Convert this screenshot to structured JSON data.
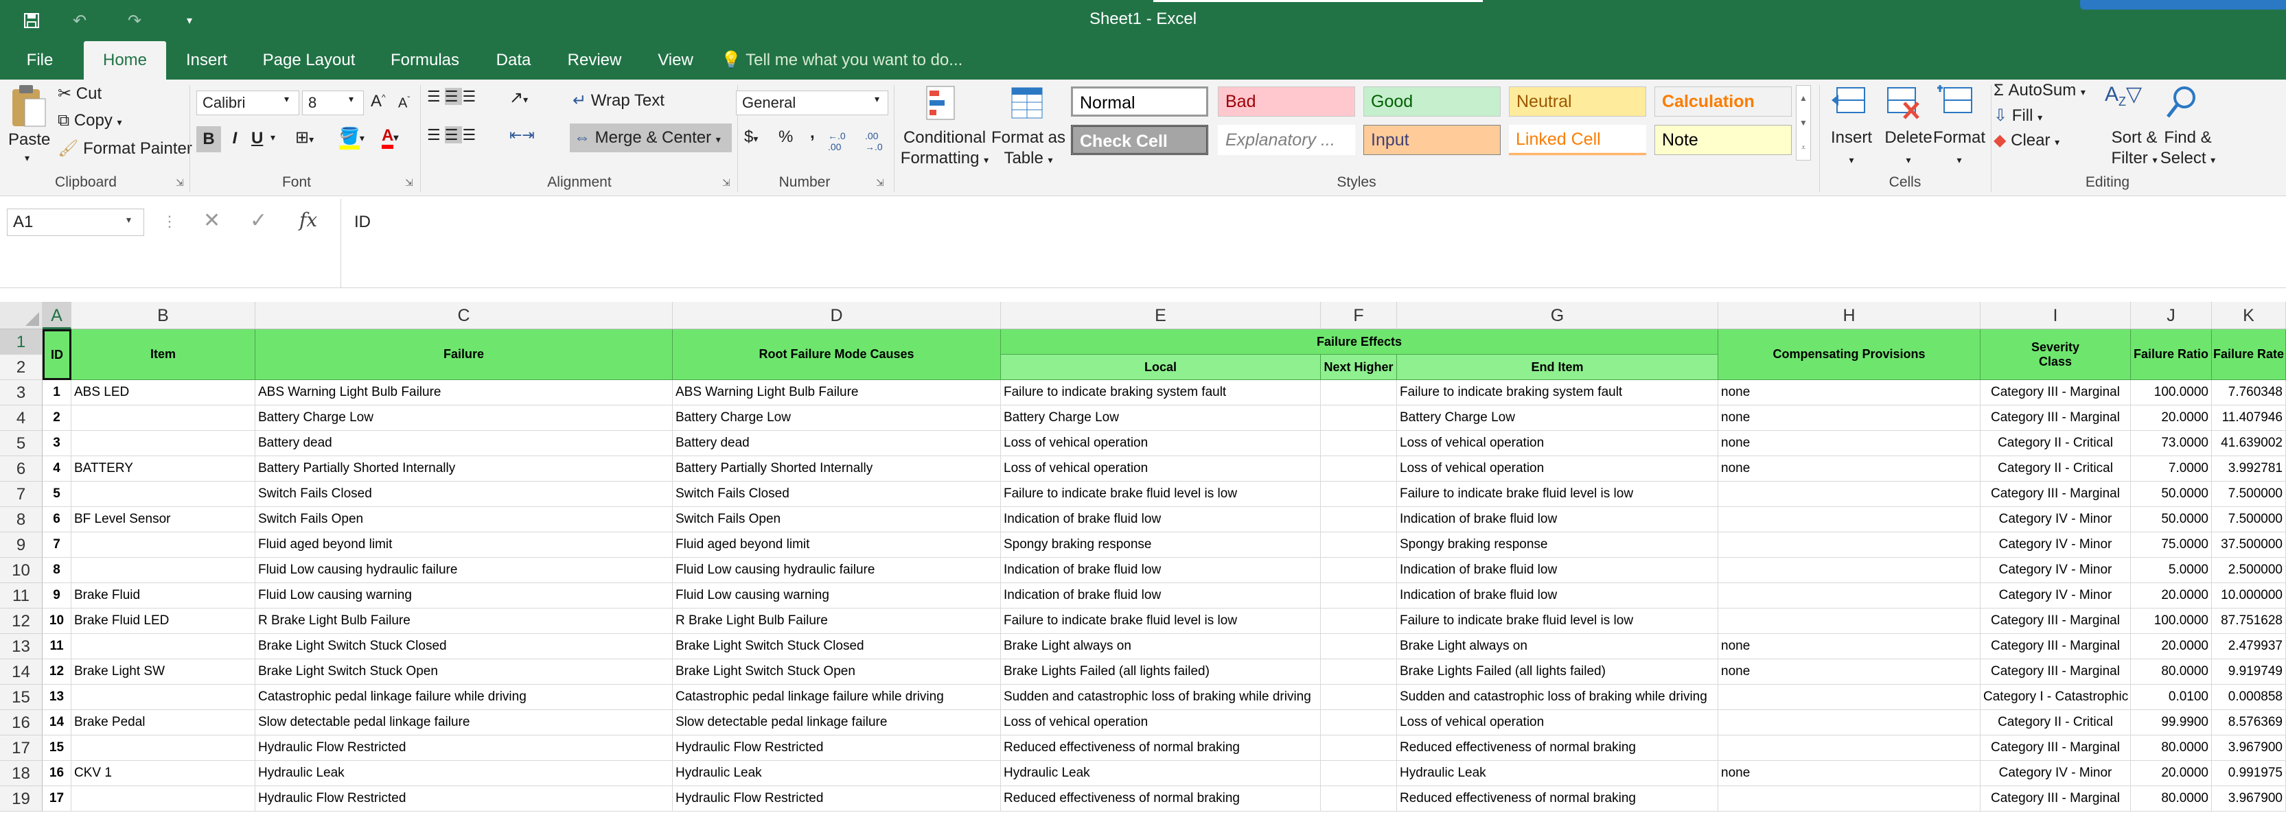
{
  "window": {
    "title": "Sheet1 - Excel"
  },
  "tabs": [
    {
      "label": "File"
    },
    {
      "label": "Home"
    },
    {
      "label": "Insert"
    },
    {
      "label": "Page Layout"
    },
    {
      "label": "Formulas"
    },
    {
      "label": "Data"
    },
    {
      "label": "Review"
    },
    {
      "label": "View"
    }
  ],
  "tellme": "Tell me what you want to do...",
  "clipboard": {
    "paste": "Paste",
    "cut": "Cut",
    "copy": "Copy",
    "format_painter": "Format Painter",
    "label": "Clipboard"
  },
  "font": {
    "name": "Calibri",
    "size": "8",
    "label": "Font",
    "bold": "B",
    "italic": "I",
    "underline": "U"
  },
  "alignment": {
    "wrap": "Wrap Text",
    "merge": "Merge & Center",
    "label": "Alignment"
  },
  "number": {
    "format": "General",
    "label": "Number",
    "currency": "$",
    "percent": "%",
    "comma": ","
  },
  "styles": {
    "conditional": "Conditional",
    "formatting": "Formatting",
    "format_as": "Format as",
    "table": "Table",
    "label": "Styles",
    "items": [
      {
        "label": "Normal",
        "bg": "#ffffff",
        "fg": "#000000"
      },
      {
        "label": "Bad",
        "bg": "#ffc7ce",
        "fg": "#9c0006"
      },
      {
        "label": "Good",
        "bg": "#c6efce",
        "fg": "#006100"
      },
      {
        "label": "Neutral",
        "bg": "#ffeb9c",
        "fg": "#9c5700"
      },
      {
        "label": "Calculation",
        "bg": "#f2f2f2",
        "fg": "#fa7d00"
      },
      {
        "label": "Check Cell",
        "bg": "#a5a5a5",
        "fg": "#ffffff"
      },
      {
        "label": "Explanatory ...",
        "bg": "#ffffff",
        "fg": "#7f7f7f"
      },
      {
        "label": "Input",
        "bg": "#ffcc99",
        "fg": "#3f3f76"
      },
      {
        "label": "Linked Cell",
        "bg": "#ffffff",
        "fg": "#fa7d00"
      },
      {
        "label": "Note",
        "bg": "#ffffcc",
        "fg": "#000000"
      }
    ]
  },
  "cells_group": {
    "insert": "Insert",
    "delete": "Delete",
    "format": "Format",
    "label": "Cells"
  },
  "editing": {
    "autosum": "AutoSum",
    "fill": "Fill",
    "clear": "Clear",
    "sort": "Sort &",
    "filter": "Filter",
    "find": "Find &",
    "select": "Select",
    "label": "Editing"
  },
  "formula_bar": {
    "name_box": "A1",
    "fx": "fx",
    "content": "ID"
  },
  "columns": [
    "A",
    "B",
    "C",
    "D",
    "E",
    "F",
    "G",
    "H",
    "I",
    "J",
    "K"
  ],
  "header": {
    "id": "ID",
    "item": "Item",
    "failure": "Failure",
    "root": "Root Failure Mode Causes",
    "effects": "Failure Effects",
    "local": "Local",
    "next_higher": "Next Higher",
    "end_item": "End Item",
    "compensating": "Compensating Provisions",
    "severity": "Severity\nClass",
    "ratio": "Failure Ratio",
    "rate": "Failure Rate"
  },
  "row_numbers": [
    "1",
    "2",
    "3",
    "4",
    "5",
    "6",
    "7",
    "8",
    "9",
    "10",
    "11",
    "12",
    "13",
    "14",
    "15",
    "16",
    "17",
    "18",
    "19"
  ],
  "rows": [
    {
      "id": "1",
      "item": "ABS LED",
      "failure": "ABS Warning Light Bulb Failure",
      "root": "ABS Warning Light Bulb Failure",
      "local": "Failure to indicate braking system fault",
      "next": "",
      "end": "Failure to indicate braking system fault",
      "comp": "none",
      "sev": "Category III - Marginal",
      "ratio": "100.0000",
      "rate": "7.760348"
    },
    {
      "id": "2",
      "item": "",
      "failure": "Battery Charge Low",
      "root": "Battery Charge Low",
      "local": "Battery Charge Low",
      "next": "",
      "end": "Battery Charge Low",
      "comp": "none",
      "sev": "Category III - Marginal",
      "ratio": "20.0000",
      "rate": "11.407946"
    },
    {
      "id": "3",
      "item": "",
      "failure": "Battery dead",
      "root": "Battery dead",
      "local": "Loss of vehical operation",
      "next": "",
      "end": "Loss of vehical operation",
      "comp": "none",
      "sev": "Category II - Critical",
      "ratio": "73.0000",
      "rate": "41.639002"
    },
    {
      "id": "4",
      "item": "BATTERY",
      "failure": "Battery Partially Shorted Internally",
      "root": "Battery Partially Shorted Internally",
      "local": "Loss of vehical operation",
      "next": "",
      "end": "Loss of vehical operation",
      "comp": "none",
      "sev": "Category II - Critical",
      "ratio": "7.0000",
      "rate": "3.992781"
    },
    {
      "id": "5",
      "item": "",
      "failure": "Switch Fails Closed",
      "root": "Switch Fails Closed",
      "local": "Failure to indicate brake fluid level is low",
      "next": "",
      "end": "Failure to indicate brake fluid level is low",
      "comp": "",
      "sev": "Category III - Marginal",
      "ratio": "50.0000",
      "rate": "7.500000"
    },
    {
      "id": "6",
      "item": "BF Level Sensor",
      "failure": "Switch Fails Open",
      "root": "Switch Fails Open",
      "local": "Indication of brake fluid low",
      "next": "",
      "end": "Indication of brake fluid low",
      "comp": "",
      "sev": "Category IV - Minor",
      "ratio": "50.0000",
      "rate": "7.500000"
    },
    {
      "id": "7",
      "item": "",
      "failure": "Fluid aged beyond limit",
      "root": "Fluid aged beyond limit",
      "local": "Spongy braking response",
      "next": "",
      "end": "Spongy braking response",
      "comp": "",
      "sev": "Category IV - Minor",
      "ratio": "75.0000",
      "rate": "37.500000"
    },
    {
      "id": "8",
      "item": "",
      "failure": "Fluid Low causing hydraulic failure",
      "root": "Fluid Low causing hydraulic failure",
      "local": "Indication of brake fluid low",
      "next": "",
      "end": "Indication of brake fluid low",
      "comp": "",
      "sev": "Category IV - Minor",
      "ratio": "5.0000",
      "rate": "2.500000"
    },
    {
      "id": "9",
      "item": "Brake Fluid",
      "failure": "Fluid Low causing warning",
      "root": "Fluid Low causing warning",
      "local": "Indication of brake fluid low",
      "next": "",
      "end": "Indication of brake fluid low",
      "comp": "",
      "sev": "Category IV - Minor",
      "ratio": "20.0000",
      "rate": "10.000000"
    },
    {
      "id": "10",
      "item": "Brake Fluid LED",
      "failure": "R Brake Light Bulb Failure",
      "root": "R Brake Light Bulb Failure",
      "local": "Failure to indicate brake fluid level is low",
      "next": "",
      "end": "Failure to indicate brake fluid level is low",
      "comp": "",
      "sev": "Category III - Marginal",
      "ratio": "100.0000",
      "rate": "87.751628"
    },
    {
      "id": "11",
      "item": "",
      "failure": "Brake Light Switch Stuck Closed",
      "root": "Brake Light Switch Stuck Closed",
      "local": "Brake Light always on",
      "next": "",
      "end": "Brake Light always on",
      "comp": "none",
      "sev": "Category III - Marginal",
      "ratio": "20.0000",
      "rate": "2.479937"
    },
    {
      "id": "12",
      "item": "Brake Light SW",
      "failure": "Brake Light Switch Stuck Open",
      "root": "Brake Light Switch Stuck Open",
      "local": "Brake Lights Failed (all lights failed)",
      "next": "",
      "end": "Brake Lights Failed (all lights failed)",
      "comp": "none",
      "sev": "Category III - Marginal",
      "ratio": "80.0000",
      "rate": "9.919749"
    },
    {
      "id": "13",
      "item": "",
      "failure": "Catastrophic pedal linkage failure while driving",
      "root": "Catastrophic pedal linkage failure while driving",
      "local": "Sudden and catastrophic loss of braking while driving",
      "next": "",
      "end": "Sudden and catastrophic loss of braking while driving",
      "comp": "",
      "sev": "Category I - Catastrophic",
      "ratio": "0.0100",
      "rate": "0.000858"
    },
    {
      "id": "14",
      "item": "Brake Pedal",
      "failure": "Slow detectable pedal linkage failure",
      "root": "Slow detectable pedal linkage failure",
      "local": "Loss of vehical operation",
      "next": "",
      "end": "Loss of vehical operation",
      "comp": "",
      "sev": "Category II - Critical",
      "ratio": "99.9900",
      "rate": "8.576369"
    },
    {
      "id": "15",
      "item": "",
      "failure": "Hydraulic Flow Restricted",
      "root": "Hydraulic Flow Restricted",
      "local": "Reduced effectiveness of normal braking",
      "next": "",
      "end": "Reduced effectiveness of normal braking",
      "comp": "",
      "sev": "Category III - Marginal",
      "ratio": "80.0000",
      "rate": "3.967900"
    },
    {
      "id": "16",
      "item": "CKV 1",
      "failure": "Hydraulic Leak",
      "root": "Hydraulic Leak",
      "local": "Hydraulic Leak",
      "next": "",
      "end": "Hydraulic Leak",
      "comp": "none",
      "sev": "Category IV - Minor",
      "ratio": "20.0000",
      "rate": "0.991975"
    },
    {
      "id": "17",
      "item": "",
      "failure": "Hydraulic Flow Restricted",
      "root": "Hydraulic Flow Restricted",
      "local": "Reduced effectiveness of normal braking",
      "next": "",
      "end": "Reduced effectiveness of normal braking",
      "comp": "",
      "sev": "Category III - Marginal",
      "ratio": "80.0000",
      "rate": "3.967900"
    }
  ]
}
